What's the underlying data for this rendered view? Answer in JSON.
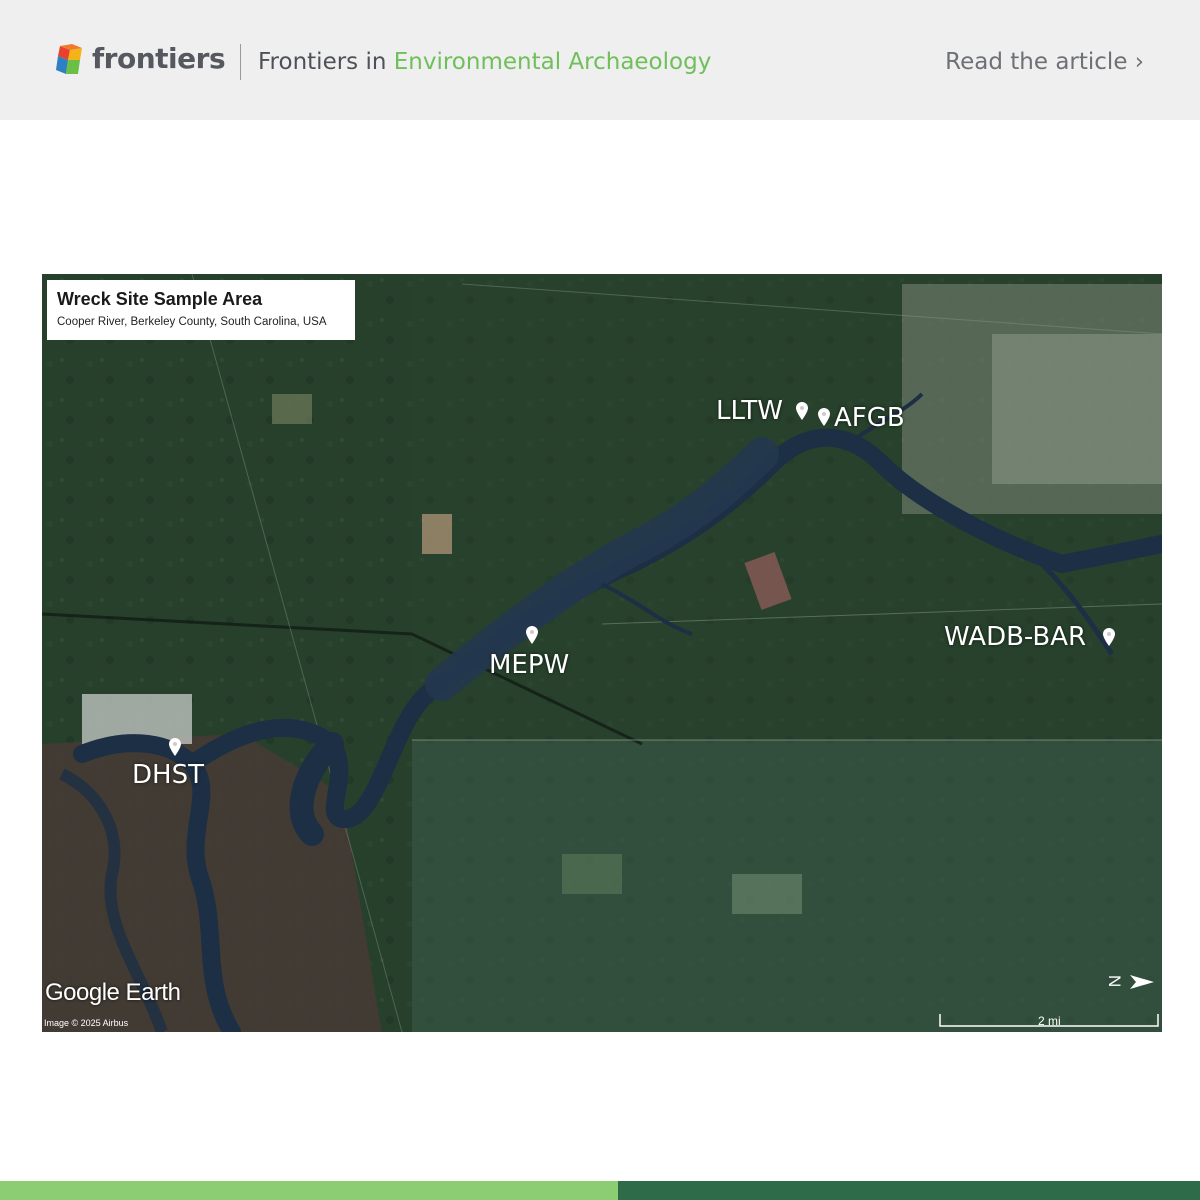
{
  "header": {
    "brand": "frontiers",
    "journal_prefix": "Frontiers in",
    "journal_name": "Environmental Archaeology",
    "read_link": "Read the article ›"
  },
  "map": {
    "legend_title": "Wreck Site Sample Area",
    "legend_subtitle": "Cooper River, Berkeley County, South Carolina, USA",
    "sites": [
      "LLTW",
      "AFGB",
      "MEPW",
      "WADB-BAR",
      "DHST"
    ],
    "provider_logo": "Google Earth",
    "imagery_credit": "Image © 2025 Airbus",
    "scale_label": "2 mi",
    "north_arrow_label": "N",
    "compass_icon": "north-arrow-icon",
    "pin_icon": "map-pin-icon"
  },
  "colors": {
    "header_bg": "#efefef",
    "accent_green": "#6fbf5a",
    "footer_light": "#8ccc73",
    "footer_dark": "#2e6b49",
    "river": "#1c2f45"
  }
}
